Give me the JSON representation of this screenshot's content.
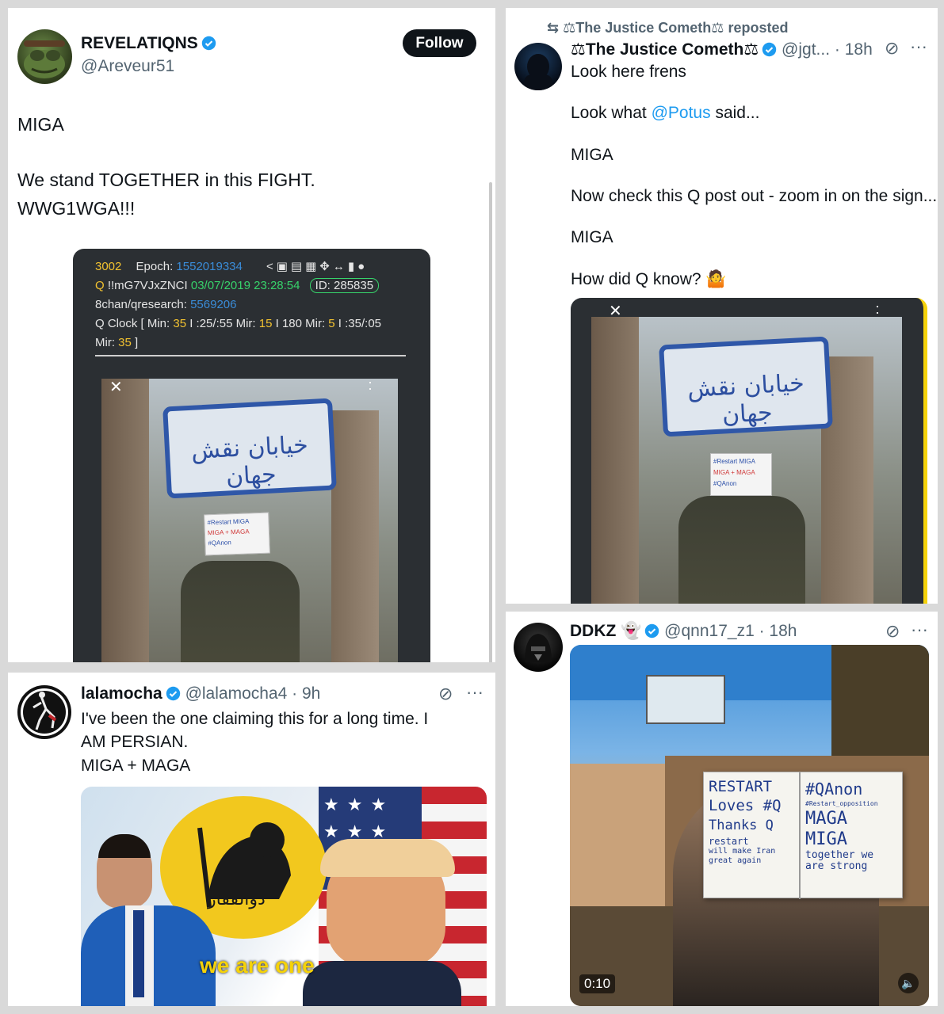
{
  "post1": {
    "display_name": "REVELATIQNS",
    "handle": "@Areveur51",
    "follow_label": "Follow",
    "text_line1": "MIGA",
    "text_line2": "We stand TOGETHER in this FIGHT.",
    "text_line3": "WWG1WGA!!!",
    "qpost": {
      "number": "3002",
      "epoch_label": "Epoch:",
      "epoch_value": "1552019334",
      "q_label": "Q",
      "tripcode": "!!mG7VJxZNCI",
      "datetime": "03/07/2019 23:28:54",
      "id": "ID: 285835",
      "board": "8chan/qresearch:",
      "board_post": "5569206",
      "clock_line1_a": "Q Clock [ Min: ",
      "clock_min1": "35",
      "clock_line1_b": " I :25/:55 Mir: ",
      "clock_mir1": "15",
      "clock_line1_c": " I 180 Mir: ",
      "clock_mir2": "5",
      "clock_line1_d": " I :35/:05",
      "clock_line2_a": "Mir: ",
      "clock_mir3": "35",
      "clock_line2_b": " ]"
    }
  },
  "post2": {
    "repost_label": "The Justice Cometh",
    "repost_suffix": "reposted",
    "display_name": "The Justice Cometh",
    "handle_time": "@jgt... · 18h",
    "line1": "Look here frens",
    "line2_a": "Look what ",
    "line2_mention": "@Potus",
    "line2_b": " said...",
    "line3": "MIGA",
    "line4": "Now check this Q post out - zoom in on the sign...",
    "line5": "MIGA",
    "line6": "How did Q know?"
  },
  "post3": {
    "display_name": "lalamocha",
    "handle_time": "@lalamocha4 · 9h",
    "line1": "I've been the one claiming this for a long time. I",
    "line2": "AM PERSIAN.",
    "line3": "MIGA + MAGA",
    "image_caption": "we are one",
    "flag_script": "ذوالفقار"
  },
  "post4": {
    "display_name": "DDKZ",
    "handle_time": "@qnn17_z1 · 18h",
    "video_time": "0:10",
    "sign_left": [
      "RESTART",
      "Loves #Q",
      "Thanks Q",
      "restart",
      "will make Iran",
      "great again"
    ],
    "sign_right": [
      "#QAnon",
      "#Restart_opposition",
      "MAGA",
      "MIGA",
      "together we",
      "are strong"
    ]
  },
  "street_sign": {
    "persian": "خیابان نقش جهان",
    "held_sign": [
      "#Restart MIGA",
      "MIGA + MAGA",
      "#QAnon"
    ]
  },
  "colors": {
    "accent": "#1d9bf0",
    "verified": "#1d9bf0",
    "muted": "#536471"
  }
}
